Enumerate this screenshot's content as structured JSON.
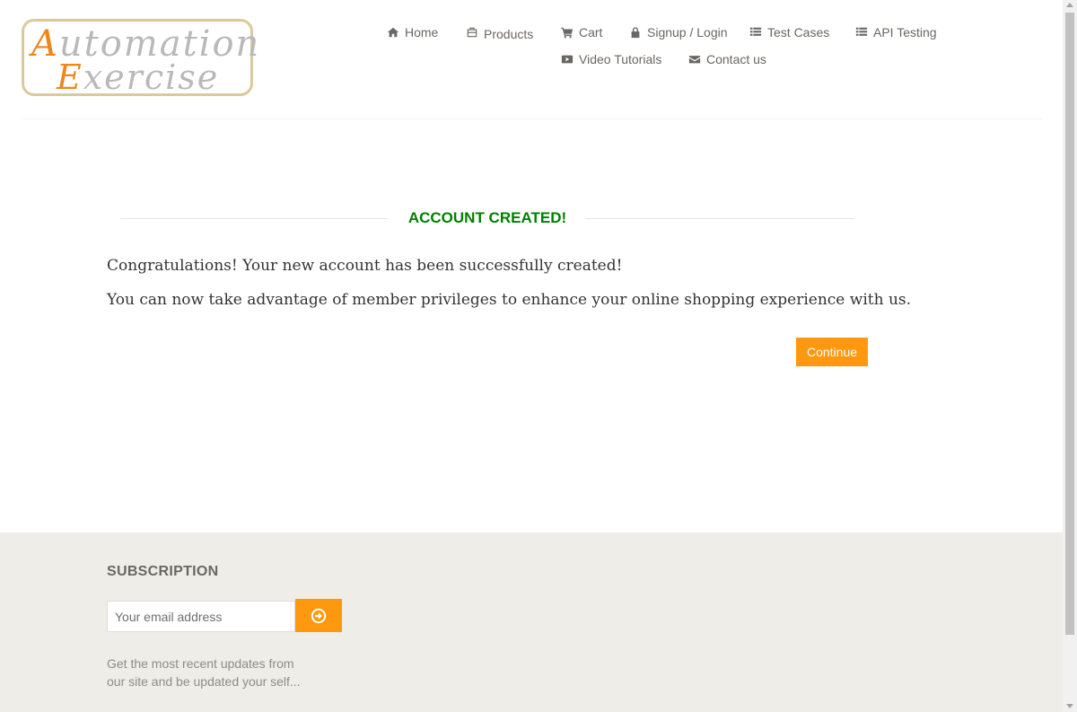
{
  "logo": {
    "line1_cap": "A",
    "line1_rest": "utomation",
    "line2_cap": "E",
    "line2_rest": "xercise"
  },
  "nav": {
    "items": [
      {
        "label": "Home",
        "icon": "home-icon"
      },
      {
        "label": "Products",
        "icon": "products-icon"
      },
      {
        "label": "Cart",
        "icon": "cart-icon"
      },
      {
        "label": "Signup / Login",
        "icon": "lock-icon"
      },
      {
        "label": "Test Cases",
        "icon": "list-icon"
      },
      {
        "label": "API Testing",
        "icon": "list-icon"
      },
      {
        "label": "Video Tutorials",
        "icon": "youtube-icon"
      },
      {
        "label": "Contact us",
        "icon": "envelope-icon"
      }
    ]
  },
  "main": {
    "title": "ACCOUNT CREATED!",
    "message1": "Congratulations! Your new account has been successfully created!",
    "message2": "You can now take advantage of member privileges to enhance your online shopping experience with us.",
    "continue_label": "Continue"
  },
  "footer": {
    "subscription_title": "SUBSCRIPTION",
    "email_placeholder": "Your email address",
    "description": "Get the most recent updates from our site and be updated your self..."
  },
  "colors": {
    "accent": "#fe980f",
    "success": "#008000",
    "footer_bg": "#efede8",
    "nav_text": "#696763"
  }
}
